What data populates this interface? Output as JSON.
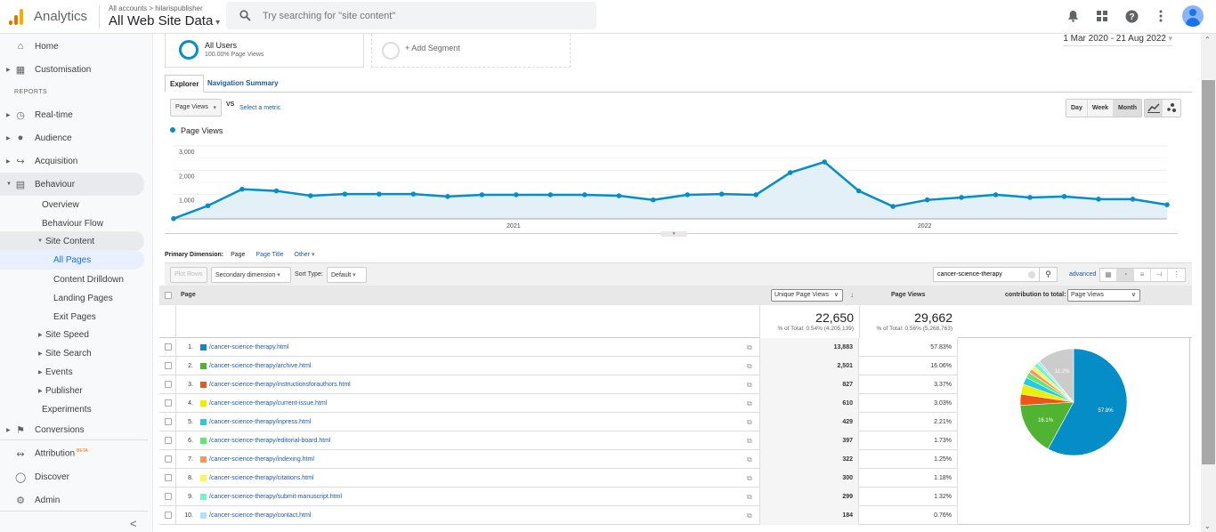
{
  "topbar": {
    "app_title": "Analytics",
    "account_breadcrumb": "All accounts > hilarispublisher",
    "property": "All Web Site Data",
    "search_placeholder": "Try searching for \"site content\"",
    "icons": [
      "bell-icon",
      "apps-grid-icon",
      "help-icon",
      "more-vert-icon",
      "account-avatar"
    ],
    "logo_colors": [
      "#f9ab00",
      "#e37400",
      "#e37400"
    ]
  },
  "sidebar": {
    "top_items": [
      {
        "label": "Home",
        "icon": "home-icon"
      },
      {
        "label": "Customisation",
        "icon": "dashboard-icon"
      }
    ],
    "reports_header": "REPORTS",
    "report_items": [
      {
        "label": "Real-time",
        "icon": "clock-icon"
      },
      {
        "label": "Audience",
        "icon": "person-icon"
      },
      {
        "label": "Acquisition",
        "icon": "acquisition-icon"
      },
      {
        "label": "Behaviour",
        "icon": "behaviour-icon",
        "expanded": true
      }
    ],
    "behaviour_children": [
      {
        "label": "Overview"
      },
      {
        "label": "Behaviour Flow"
      },
      {
        "label": "Site Content",
        "expanded": true
      },
      {
        "label": "All Pages",
        "active": true
      },
      {
        "label": "Content Drilldown"
      },
      {
        "label": "Landing Pages"
      },
      {
        "label": "Exit Pages"
      },
      {
        "label": "Site Speed"
      },
      {
        "label": "Site Search"
      },
      {
        "label": "Events"
      },
      {
        "label": "Publisher"
      },
      {
        "label": "Experiments"
      }
    ],
    "conversions": "Conversions",
    "bottom_items": [
      {
        "label": "Attribution",
        "badge": "BETA",
        "icon": "attribution-icon"
      },
      {
        "label": "Discover",
        "icon": "lightbulb-icon"
      },
      {
        "label": "Admin",
        "icon": "gear-icon"
      }
    ],
    "collapse_icon": "<"
  },
  "segments": {
    "active": {
      "name": "All Users",
      "sub": "100.00% Page Views"
    },
    "add": "+ Add Segment"
  },
  "date_range": "1 Mar 2020 - 21 Aug 2022",
  "tabs": [
    {
      "label": "Explorer",
      "active": true
    },
    {
      "label": "Navigation Summary"
    }
  ],
  "metric_select": "Page Views",
  "vs_label": "VS",
  "select_metric_link": "Select a metric",
  "granularity": [
    {
      "label": "Day"
    },
    {
      "label": "Week"
    },
    {
      "label": "Month",
      "active": true
    }
  ],
  "chart_type_buttons": [
    "line-chart-icon",
    "motion-chart-icon"
  ],
  "chart_data": {
    "type": "area",
    "title": "",
    "legend": [
      "Page Views"
    ],
    "legend_position": "top-left",
    "xlabel": "",
    "ylabel": "",
    "x_tick_labels": [
      {
        "label": "2021",
        "index": 10
      },
      {
        "label": "2022",
        "index": 22
      }
    ],
    "y_ticks": [
      "1,000",
      "2,000",
      "3,000"
    ],
    "ylim": [
      0,
      3000
    ],
    "grid": true,
    "series": [
      {
        "name": "Page Views",
        "color": "#058dc7",
        "values": [
          10,
          540,
          1220,
          1150,
          950,
          1020,
          1020,
          1020,
          920,
          990,
          990,
          990,
          990,
          950,
          780,
          990,
          1020,
          990,
          1900,
          2340,
          1150,
          510,
          780,
          880,
          990,
          880,
          920,
          810,
          810,
          580
        ]
      }
    ]
  },
  "table_controls": {
    "primary_dimension_label": "Primary Dimension:",
    "primary_dimension_current": "Page",
    "primary_dimension_links": [
      "Page Title",
      "Other"
    ],
    "plot_rows": "Plot Rows",
    "secondary_dimension": "Secondary dimension",
    "sort_type_label": "Sort Type:",
    "sort_type_value": "Default",
    "filter_value": "cancer-science-therapy",
    "advanced_link": "advanced",
    "view_icons": [
      "data-table-icon",
      "percentage-pie-icon",
      "performance-bar-icon",
      "comparison-icon",
      "term-cloud-icon"
    ]
  },
  "table": {
    "header_page": "Page",
    "sort_metric": "Unique Page Views",
    "header_page_views": "Page Views",
    "contribution_label": "contribution to total:",
    "contribution_metric": "Page Views",
    "totals": {
      "unique_page_views": "22,650",
      "unique_page_views_sub": "% of Total: 0.54% (4,205,139)",
      "page_views": "29,662",
      "page_views_sub": "% of Total: 0.56% (5,268,763)"
    },
    "rows": [
      {
        "num": "1.",
        "page": "/cancer-science-therapy.html",
        "color": "#058dc7",
        "upv": "13,883",
        "pct": "57.83%"
      },
      {
        "num": "2.",
        "page": "/cancer-science-therapy/archive.html",
        "color": "#50b432",
        "upv": "2,501",
        "pct": "16.06%"
      },
      {
        "num": "3.",
        "page": "/cancer-science-therapy/instructionsforauthors.html",
        "color": "#ed561b",
        "upv": "827",
        "pct": "3.37%"
      },
      {
        "num": "4.",
        "page": "/cancer-science-therapy/current-issue.html",
        "color": "#edef00",
        "upv": "610",
        "pct": "3.03%"
      },
      {
        "num": "5.",
        "page": "/cancer-science-therapy/inpress.html",
        "color": "#24cbe5",
        "upv": "429",
        "pct": "2.21%"
      },
      {
        "num": "6.",
        "page": "/cancer-science-therapy/editorial-board.html",
        "color": "#64e572",
        "upv": "397",
        "pct": "1.73%"
      },
      {
        "num": "7.",
        "page": "/cancer-science-therapy/indexing.html",
        "color": "#ff9655",
        "upv": "322",
        "pct": "1.25%"
      },
      {
        "num": "8.",
        "page": "/cancer-science-therapy/citations.html",
        "color": "#fff263",
        "upv": "300",
        "pct": "1.18%"
      },
      {
        "num": "9.",
        "page": "/cancer-science-therapy/submit-manuscript.html",
        "color": "#6af9c4",
        "upv": "299",
        "pct": "1.32%"
      },
      {
        "num": "10.",
        "page": "/cancer-science-therapy/contact.html",
        "color": "#b2deff",
        "upv": "184",
        "pct": "0.76%"
      }
    ],
    "pie": {
      "other_color": "#cccccc",
      "other_pct": 11.06,
      "labels": {
        "first": "57.8%",
        "second": "16.1%",
        "other": "11.2%"
      }
    }
  }
}
